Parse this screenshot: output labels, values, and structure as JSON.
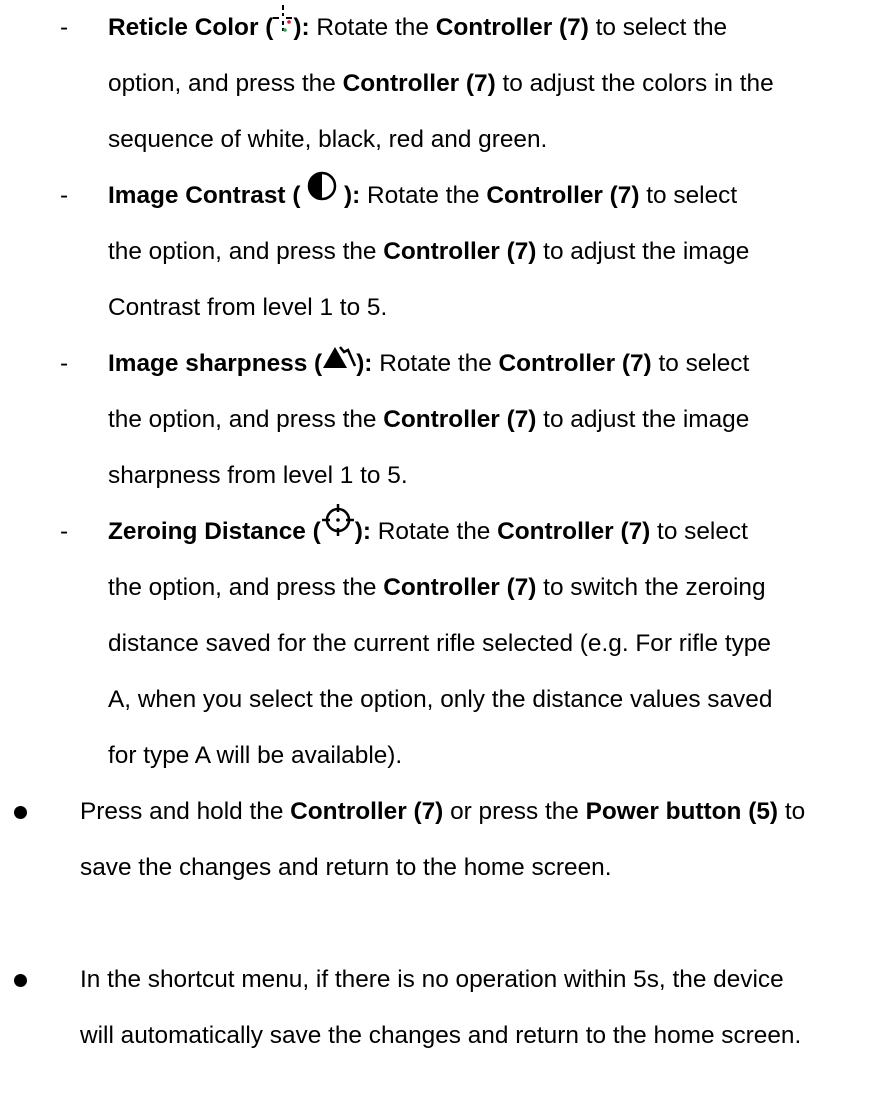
{
  "items": [
    {
      "bold": "Reticle Color (",
      "bold_end": "):",
      "icon": "reticle-color-icon",
      "l1": " Rotate the ",
      "c1": "Controller (7)",
      "l1b": " to select the",
      "l2a": "option, and press the ",
      "c2": "Controller (7)",
      "l2b": " to adjust the colors in the",
      "l3": "sequence of white, black, red and green."
    },
    {
      "bold": "Image Contrast (",
      "bold_end": "):",
      "icon": "contrast-icon",
      "l1": " Rotate the ",
      "c1": "Controller (7)",
      "l1b": " to select",
      "l2a": "the option, and press the ",
      "c2": "Controller (7)",
      "l2b": " to adjust the image",
      "l3": "Contrast from level 1 to 5."
    },
    {
      "bold": "Image sharpness (",
      "bold_end": "):",
      "icon": "sharpness-icon",
      "l1": " Rotate the ",
      "c1": "Controller (7)",
      "l1b": " to select",
      "l2a": "the option, and press the ",
      "c2": "Controller (7)",
      "l2b": " to adjust the image",
      "l3": "sharpness from level 1 to 5."
    },
    {
      "bold": "Zeroing Distance (",
      "bold_end": "):",
      "icon": "crosshair-icon",
      "l1": " Rotate the ",
      "c1": "Controller (7)",
      "l1b": " to select",
      "l2a": "the option, and press the ",
      "c2": "Controller (7)",
      "l2b": " to switch the zeroing",
      "l3": "distance saved for the current rifle selected (e.g. For rifle type",
      "l4": "A, when you select the option, only the distance values saved",
      "l5": "for type A will be available)."
    }
  ],
  "dash": "-",
  "bullets": [
    {
      "a": "Press and hold the ",
      "b1": "Controller (7)",
      "c": " or press the ",
      "b2": "Power button (5)",
      "d": " to",
      "l2": "save the changes and return to the home screen."
    },
    {
      "l1": "In the shortcut menu, if there is no operation within 5s, the device",
      "l2": "will automatically save the changes and return to the home screen."
    }
  ],
  "colors": {
    "reticle_red": "#e8112d",
    "reticle_green": "#22b14c"
  }
}
